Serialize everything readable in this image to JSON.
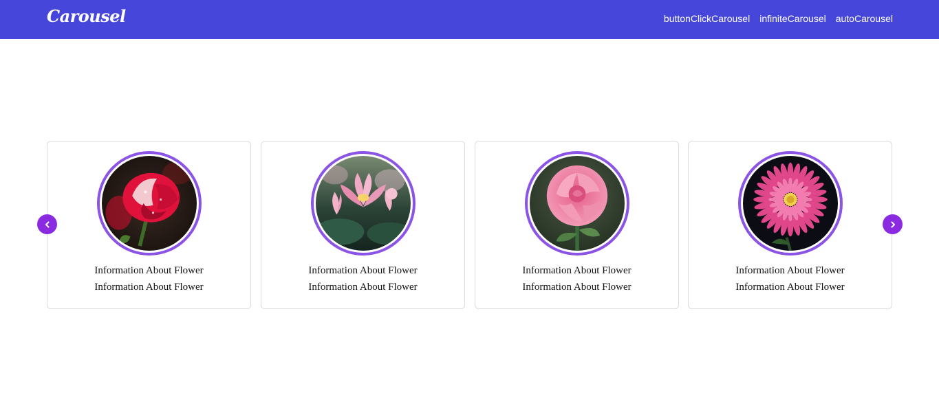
{
  "header": {
    "brand": "Carousel",
    "nav": [
      "buttonClickCarousel",
      "infiniteCarousel",
      "autoCarousel"
    ]
  },
  "carousel": {
    "cards": [
      {
        "line1": "Information About Flower",
        "line2": "Information About Flower",
        "image": "red-white-rose"
      },
      {
        "line1": "Information About Flower",
        "line2": "Information About Flower",
        "image": "pink-lotus"
      },
      {
        "line1": "Information About Flower",
        "line2": "Information About Flower",
        "image": "pink-rose"
      },
      {
        "line1": "Information About Flower",
        "line2": "Information About Flower",
        "image": "pink-chrysanthemum"
      }
    ],
    "prev_icon": "chevron-left-icon",
    "next_icon": "chevron-right-icon"
  },
  "colors": {
    "navbar": "#4646DB",
    "accent": "#8A2BE2",
    "ring": "#8B53E6"
  }
}
